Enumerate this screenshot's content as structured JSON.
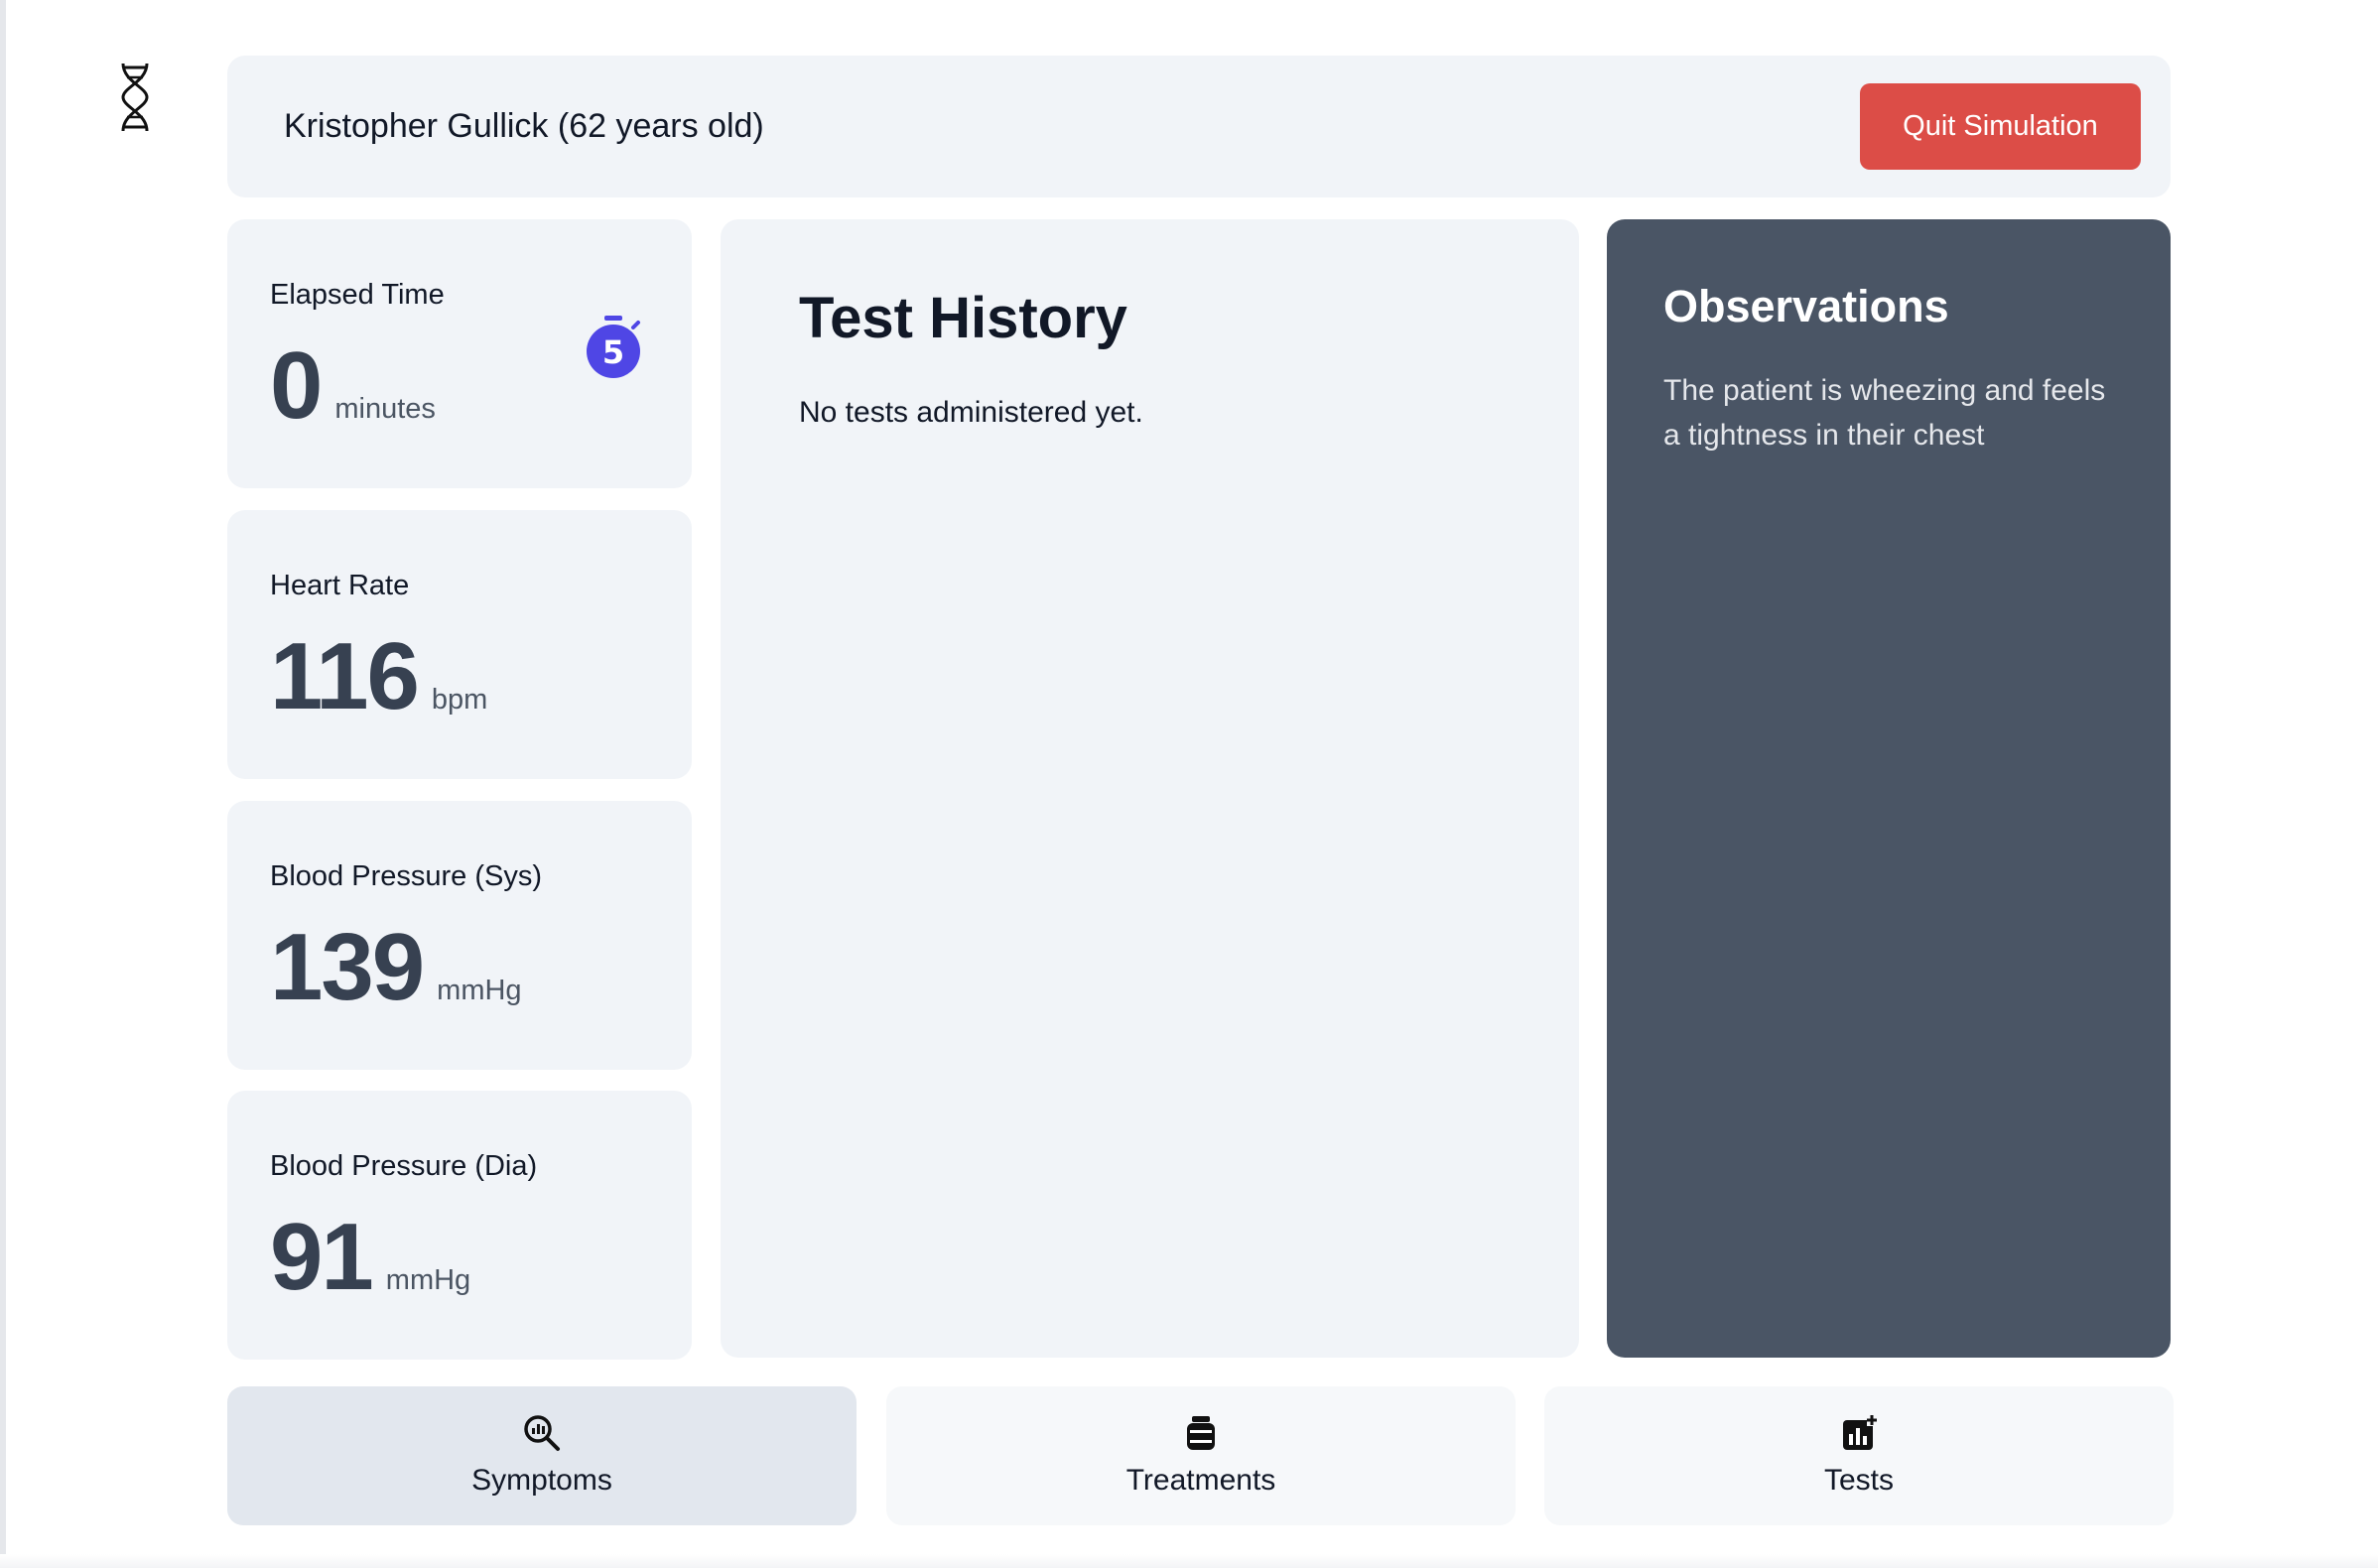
{
  "header": {
    "patient": "Kristopher Gullick (62 years old)",
    "quit_label": "Quit Simulation"
  },
  "stats": {
    "elapsed": {
      "label": "Elapsed Time",
      "value": "0",
      "unit": "minutes",
      "badge": "5"
    },
    "heart_rate": {
      "label": "Heart Rate",
      "value": "116",
      "unit": "bpm"
    },
    "bp_sys": {
      "label": "Blood Pressure (Sys)",
      "value": "139",
      "unit": "mmHg"
    },
    "bp_dia": {
      "label": "Blood Pressure (Dia)",
      "value": "91",
      "unit": "mmHg"
    }
  },
  "test_history": {
    "title": "Test History",
    "empty_text": "No tests administered yet."
  },
  "observations": {
    "title": "Observations",
    "text": "The patient is wheezing and feels a tightness in their chest"
  },
  "nav": {
    "symptoms": "Symptoms",
    "treatments": "Treatments",
    "tests": "Tests"
  },
  "icons": {
    "logo": "dna-icon",
    "timer": "stopwatch-icon",
    "symptoms": "magnifier-chart-icon",
    "treatments": "medicine-jar-icon",
    "tests": "chart-plus-icon"
  },
  "colors": {
    "accent": "#4f46e5",
    "danger": "#dc4d47",
    "observations_bg": "#4a5565"
  }
}
